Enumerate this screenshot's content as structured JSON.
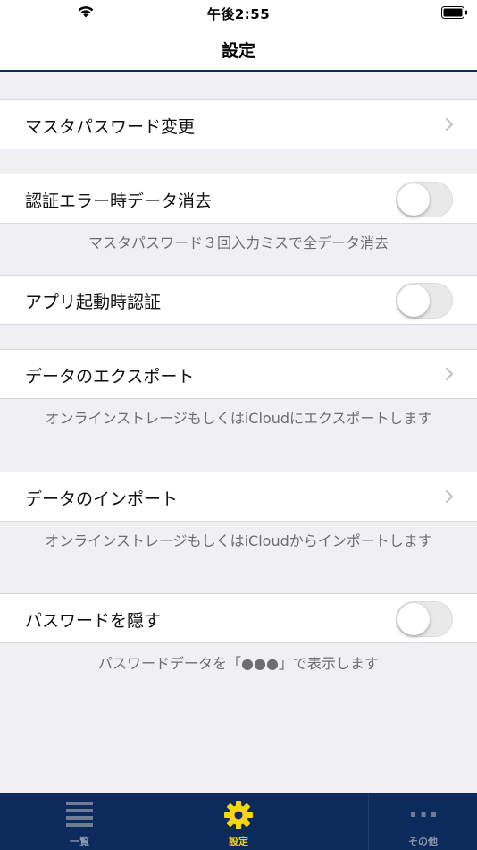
{
  "status_bar": {
    "time": "午後2:55",
    "icons": [
      "wifi-icon",
      "battery-icon"
    ]
  },
  "nav": {
    "title": "設定"
  },
  "settings": {
    "master_password_change": {
      "label": "マスタパスワード変更",
      "control": "chevron"
    },
    "wipe_on_auth_error": {
      "label": "認証エラー時データ消去",
      "control": "toggle",
      "enabled": false,
      "footer": "マスタパスワード３回入力ミスで全データ消去"
    },
    "auth_on_launch": {
      "label": "アプリ起動時認証",
      "control": "toggle",
      "enabled": false
    },
    "data_export": {
      "label": "データのエクスポート",
      "control": "chevron",
      "footer": "オンラインストレージもしくはiCloudにエクスポートします"
    },
    "data_import": {
      "label": "データのインポート",
      "control": "chevron",
      "footer": "オンラインストレージもしくはiCloudからインポートします"
    },
    "hide_password": {
      "label": "パスワードを隠す",
      "control": "toggle",
      "enabled": false,
      "footer": "パスワードデータを「●●●」で表示します"
    }
  },
  "tab_bar": {
    "items": [
      {
        "label": "一覧",
        "icon": "list-icon",
        "selected": false
      },
      {
        "label": "設定",
        "icon": "gear-icon",
        "selected": true
      },
      {
        "label": "その他",
        "icon": "more-icon",
        "selected": false
      }
    ]
  },
  "colors": {
    "accent_navy": "#0d2a5c",
    "tab_selected": "#f5d60b",
    "tab_unselected": "#8a97ad",
    "grouped_background": "#efeff4",
    "footer_text": "#6d6d72"
  }
}
